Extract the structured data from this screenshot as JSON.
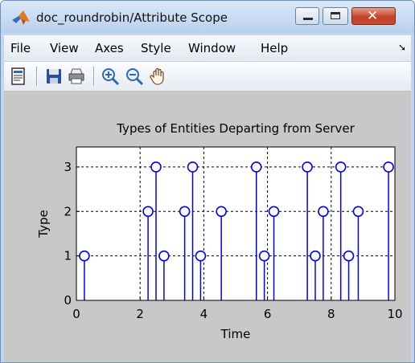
{
  "window": {
    "title": "doc_roundrobin/Attribute Scope",
    "controls": [
      "minimize-icon",
      "maximize-icon",
      "close-icon"
    ]
  },
  "menu": {
    "items": [
      "File",
      "View",
      "Axes",
      "Style",
      "Window",
      "Help"
    ],
    "overflow_icon": "arrow-icon"
  },
  "toolbar": {
    "buttons": [
      {
        "name": "print-preview-icon"
      },
      {
        "name": "save-icon"
      },
      {
        "name": "print-icon"
      },
      {
        "name": "zoom-in-icon"
      },
      {
        "name": "zoom-out-icon"
      },
      {
        "name": "pan-hand-icon"
      }
    ]
  },
  "chart_data": {
    "type": "scatter",
    "style": "stem",
    "title": "Types of Entities Departing from Server",
    "xlabel": "Time",
    "ylabel": "Type",
    "xlim": [
      0,
      10
    ],
    "ylim": [
      0,
      3.45
    ],
    "xticks": [
      "0",
      "2",
      "4",
      "6",
      "8",
      "10"
    ],
    "yticks": [
      "0",
      "1",
      "2",
      "3"
    ],
    "grid": true,
    "marker_color": "#0000ff",
    "series": [
      {
        "x": [
          0.25,
          2.25,
          2.5,
          2.75,
          3.4,
          3.65,
          3.9,
          4.55,
          5.65,
          5.9,
          6.2,
          7.25,
          7.5,
          7.75,
          8.3,
          8.55,
          8.85,
          9.8
        ],
        "values": [
          1,
          2,
          3,
          1,
          2,
          3,
          1,
          2,
          3,
          1,
          2,
          3,
          1,
          2,
          3,
          1,
          2,
          3
        ]
      }
    ]
  }
}
